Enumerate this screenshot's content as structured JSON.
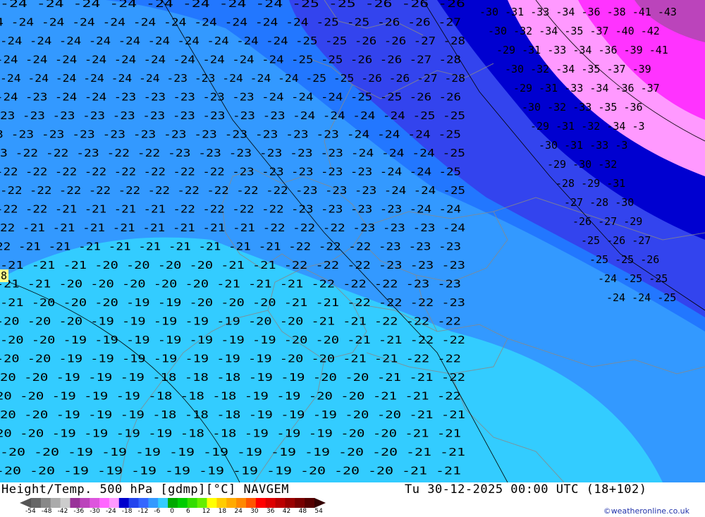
{
  "map": {
    "zone_colors": {
      "lt_minus31": "#ff33ff",
      "minus31_to_minus28": "#ff99ff",
      "minus28_to_minus26": "#0000d0",
      "minus26_to_minus24": "#3344ee",
      "minus24_to_minus22": "#2277ff",
      "minus22_to_minus20": "#3399ff",
      "gt_minus20": "#33ccff"
    },
    "row_labels": [
      "-24 -24 -24 -24 -24 -24 -24 -24 -25 -25 -26 -26 -26",
      "4 -24 -24 -24 -24 -24 -24 -24 -24 -24 -24 -25 -25 -26 -26 -27",
      "-24 -24 -24 -24 -24 -24 -24 -24 -24 -24 -25 -25 -26 -26 -27 -28",
      "-24 -24 -24 -24 -24 -24 -24 -24 -24 -24 -25 -25 -26 -26 -27 -28",
      "-24 -24 -24 -24 -24 -24 -23 -23 -24 -24 -24 -25 -25 -26 -26 -27 -28",
      "-24 -23 -24 -24 -23 -23 -23 -23 -23 -24 -24 -24 -25 -25 -26 -26",
      "23 -23 -23 -23 -23 -23 -23 -23 -23 -23 -24 -24 -24 -24 -25 -25",
      "3 -23 -23 -23 -23 -23 -23 -23 -23 -23 -23 -23 -24 -24 -24 -25",
      "3 -22 -22 -23 -22 -22 -23 -23 -23 -23 -23 -23 -24 -24 -24 -25",
      "-22 -22 -22 -22 -22 -22 -22 -22 -23 -23 -23 -23 -23 -24 -24 -25",
      "-22 -22 -22 -22 -22 -22 -22 -22 -22 -22 -23 -23 -23 -24 -24 -25",
      "-22 -22 -21 -21 -21 -21 -22 -22 -22 -22 -23 -23 -23 -23 -24 -24",
      "22 -21 -21 -21 -21 -21 -21 -21 -21 -22 -22 -22 -23 -23 -23 -24",
      "22 -21 -21 -21 -21 -21 -21 -21 -21 -21 -22 -22 -22 -23 -23 -23",
      "-21 -21 -21 -20 -20 -20 -20 -21 -21 -22 -22 -22 -23 -23 -23",
      "-21 -21 -20 -20 -20 -20 -20 -21 -21 -21 -22 -22 -22 -23 -23",
      "-21 -20 -20 -20 -19 -19 -20 -20 -20 -21 -21 -22 -22 -22 -23",
      "-20 -20 -20 -19 -19 -19 -19 -19 -20 -20 -21 -21 -22 -22 -22",
      "-20 -20 -19 -19 -19 -19 -19 -19 -19 -20 -20 -21 -21 -22 -22",
      "-20 -20 -19 -19 -19 -19 -19 -19 -19 -20 -20 -21 -21 -22 -22",
      "20 -20 -19 -19 -19 -18 -18 -18 -19 -19 -20 -20 -21 -21 -22",
      "20 -20 -19 -19 -19 -18 -18 -18 -19 -19 -20 -20 -21 -21 -22",
      "20 -20 -19 -19 -19 -18 -18 -18 -19 -19 -19 -20 -20 -21 -21",
      "20 -20 -19 -19 -19 -19 -18 -18 -19 -19 -19 -20 -20 -21 -21",
      "-20 -20 -19 -19 -19 -19 -19 -19 -19 -19 -20 -20 -21 -21",
      "-20 -20 -19 -19 -19 -19 -19 -19 -19 -20 -20 -20 -21 -21"
    ],
    "east_labels": [
      "-30 -31 -33 -34 -36 -38 -41 -43",
      "-30 -32 -34 -35 -37 -40 -42",
      "-29 -31 -33 -34 -36 -39 -41",
      "-30 -32 -34 -35 -37 -39",
      "-29 -31 -33 -34 -36 -37",
      "-30 -32 -33 -35 -36",
      "-29 -31 -32 -34 -3",
      "-30 -31 -33 -3",
      "-29 -30 -32",
      "-28 -29 -31",
      "-27 -28 -30",
      "-26 -27 -29",
      "-25 -26 -27",
      "-25 -25 -26",
      "-24 -25 -25",
      "-24 -24 -25"
    ],
    "marker_label": "8"
  },
  "footer": {
    "title": "Height/Temp. 500 hPa [gdmp][°C] NAVGEM",
    "datetime": "Tu 30-12-2025 00:00 UTC (18+102)",
    "credit": "©weatheronline.co.uk",
    "scale_labels": [
      "-54",
      "-48",
      "-42",
      "-36",
      "-30",
      "-24",
      "-18",
      "-12",
      "-6",
      "0",
      "6",
      "12",
      "18",
      "24",
      "30",
      "36",
      "42",
      "48",
      "54"
    ],
    "scale_colors": [
      "#666666",
      "#888888",
      "#aaaaaa",
      "#cccccc",
      "#993399",
      "#bb44bb",
      "#dd55dd",
      "#ff66ff",
      "#ff99ff",
      "#0000cc",
      "#2244ee",
      "#3366ff",
      "#3399ff",
      "#33ccff",
      "#00aa00",
      "#00cc00",
      "#33dd00",
      "#66ee00",
      "#ffff00",
      "#ffcc00",
      "#ffaa00",
      "#ff8800",
      "#ff5500",
      "#ff0000",
      "#dd0000",
      "#bb0000",
      "#990000",
      "#770000",
      "#550000"
    ]
  }
}
